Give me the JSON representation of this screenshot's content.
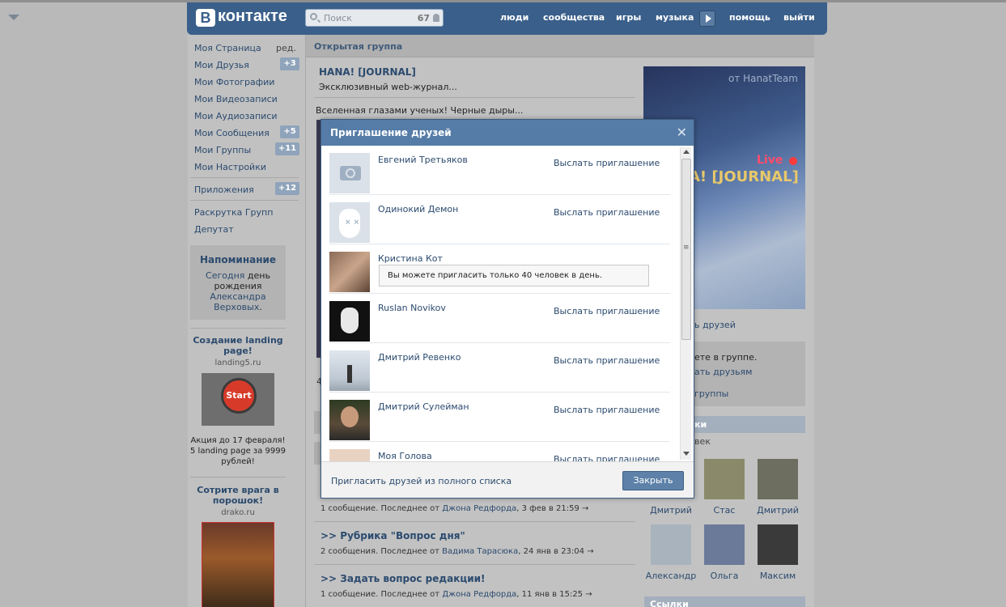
{
  "header": {
    "logo_letter": "В",
    "logo_text": "контакте",
    "search_placeholder": "Поиск",
    "search_count": "67",
    "nav": [
      "люди",
      "сообщества",
      "игры",
      "музыка",
      "помощь",
      "выйти"
    ]
  },
  "left_menu": {
    "items": [
      {
        "label": "Моя Страница",
        "extra": "ред."
      },
      {
        "label": "Мои Друзья",
        "badge": "+3"
      },
      {
        "label": "Мои Фотографии"
      },
      {
        "label": "Мои Видеозаписи"
      },
      {
        "label": "Мои Аудиозаписи"
      },
      {
        "label": "Мои Сообщения",
        "badge": "+5"
      },
      {
        "label": "Мои Группы",
        "badge": "+11"
      },
      {
        "label": "Мои Настройки"
      },
      {
        "label": "Приложения",
        "badge": "+12"
      },
      {
        "label": "Раскрутка Групп"
      },
      {
        "label": "Депутат"
      }
    ],
    "reminder": {
      "title": "Напоминание",
      "line1": "Сегодня",
      "line1b": "день",
      "line2": "рождения",
      "name1": "Александра",
      "name2": "Верховых",
      "dot": "."
    },
    "ads": [
      {
        "title": "Создание landing page!",
        "domain": "landing5.ru",
        "img_label": "Start",
        "text": "Акция до 17 февраля! 5 landing page за 9999 рублей!"
      },
      {
        "title": "Сотрите врага в порошок!",
        "domain": "drako.ru"
      }
    ]
  },
  "group": {
    "bar_title": "Открытая группа",
    "name": "HANA! [JOURNAL]",
    "description": "Эксклюзивный web-журнал...",
    "post_text": "Вселенная глазами ученых! Черные дыры...",
    "partial_4": "4"
  },
  "right_col": {
    "banner_from": "от HanatTeam",
    "banner_live": "Live",
    "banner_title": "A! [JOURNAL]",
    "invite_partial": "ь друзей",
    "in_group_partial": "ете в группе.",
    "tell_partial": "ать друзьям",
    "leave_partial": "группы",
    "members_partial": "ки",
    "count_partial": "век",
    "friends": [
      "Дмитрий",
      "Стас",
      "Дмитрий",
      "Александр",
      "Ольга",
      "Максим"
    ],
    "links_partial": "Ссылки"
  },
  "topics": [
    {
      "title": "",
      "meta": "1 сообщение. Последнее от",
      "author": "Джона Редфорда",
      "time": ", 3 фев в 21:59"
    },
    {
      "title": ">> Рубрика \"Вопрос дня\"",
      "meta": "2 сообщения. Последнее от",
      "author": "Вадима Тарасюка",
      "time": ", 24 янв в 23:04"
    },
    {
      "title": ">> Задать вопрос редакции!",
      "meta": "1 сообщение. Последнее от",
      "author": "Джона Редфорда",
      "time": ", 11 янв в 15:25"
    }
  ],
  "modal": {
    "title": "Приглашение друзей",
    "close_glyph": "✕",
    "invite_label": "Выслать приглашение",
    "warning": "Вы можете пригласить только 40 человек в день.",
    "rows": [
      {
        "name": "Евгений Третьяков",
        "avatar": "camera-placeholder"
      },
      {
        "name": "Одинокий Демон",
        "avatar": "dog-deactivated"
      },
      {
        "name": "Кристина Кот",
        "avatar": "photo",
        "warning": true
      },
      {
        "name": "Ruslan Novikov",
        "avatar": "mask-photo"
      },
      {
        "name": "Дмитрий Ревенко",
        "avatar": "photo"
      },
      {
        "name": "Дмитрий Сулейман",
        "avatar": "photo"
      },
      {
        "name": "Моя Голова",
        "avatar": "photo"
      }
    ],
    "footer_link": "Пригласить друзей из полного списка",
    "close_button": "Закрыть"
  },
  "colors": {
    "header_blue": "#3a5f8a",
    "modal_head": "#557ca7",
    "link": "#2b4a6e",
    "button": "#5d81a8"
  }
}
